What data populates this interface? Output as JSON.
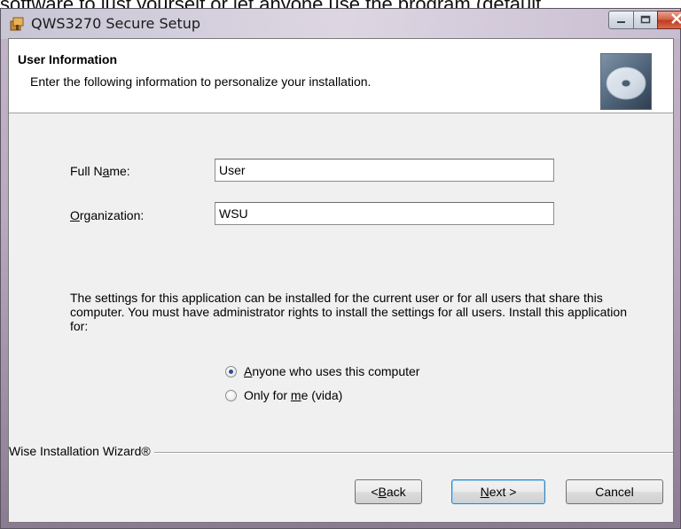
{
  "page_caption": "software to just yourself or let anyone use the program (default",
  "window": {
    "title": "QWS3270 Secure Setup",
    "controls": {
      "minimize": "minimize",
      "maximize": "maximize",
      "close": "close"
    }
  },
  "header": {
    "title": "User Information",
    "subtitle": "Enter the following information to personalize your installation.",
    "image": "cd-disc-icon"
  },
  "form": {
    "full_name_label_pre": "Full N",
    "full_name_label_key": "a",
    "full_name_label_post": "me:",
    "full_name_value": "User",
    "organization_label_key": "O",
    "organization_label_post": "rganization:",
    "organization_value": "WSU"
  },
  "install_for": {
    "description": "The settings for this application can be installed for the current user or for all users that share this computer. You must have administrator rights to install the settings for all users. Install this application for:",
    "options": [
      {
        "key": "A",
        "label_post": "nyone who uses this computer",
        "selected": true
      },
      {
        "label_pre": "Only for ",
        "key": "m",
        "label_post": "e (vida)",
        "selected": false
      }
    ]
  },
  "footer": {
    "brand": "Wise Installation Wizard®",
    "back_pre": "< ",
    "back_key": "B",
    "back_post": "ack",
    "next_key": "N",
    "next_post": "ext >",
    "cancel_label": "Cancel"
  },
  "colors": {
    "client_bg": "#f0f0f0",
    "close_button": "#c23a1e",
    "default_button_border": "#3c7fb1"
  }
}
